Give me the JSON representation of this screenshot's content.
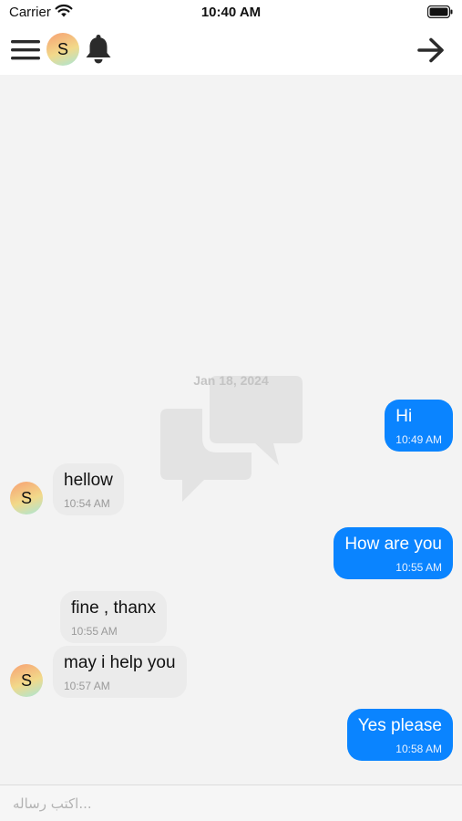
{
  "status_bar": {
    "carrier": "Carrier",
    "time": "10:40 AM"
  },
  "nav": {
    "avatar_initial": "S",
    "icons": [
      "menu-icon",
      "bell-icon",
      "arrow-right-icon"
    ]
  },
  "chat": {
    "date": "Jan 18, 2024",
    "messages": [
      {
        "direction": "out",
        "text": "Hi",
        "time": "10:49 AM"
      },
      {
        "direction": "in",
        "text": "hellow",
        "time": "10:54 AM",
        "avatar": "S"
      },
      {
        "direction": "out",
        "text": "How are you",
        "time": "10:55 AM"
      },
      {
        "direction": "in",
        "text": "fine , thanx",
        "time": "10:55 AM"
      },
      {
        "direction": "in",
        "text": "may i help you",
        "time": "10:57 AM",
        "avatar": "S"
      },
      {
        "direction": "out",
        "text": "Yes please",
        "time": "10:58 AM"
      }
    ]
  },
  "composer": {
    "placeholder": "اكتب رساله..."
  },
  "colors": {
    "outgoing_bubble": "#0a84ff",
    "incoming_bubble": "#ebebeb",
    "chat_background": "#f3f3f3"
  }
}
